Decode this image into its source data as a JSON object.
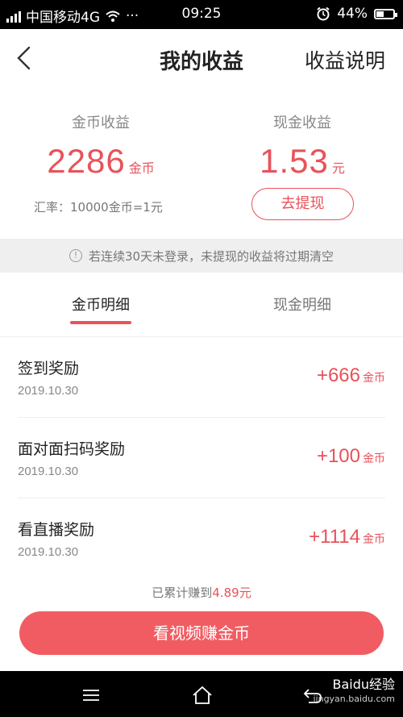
{
  "status_bar": {
    "carrier": "中国移动4G",
    "more": "···",
    "time": "09:25",
    "battery": "44%",
    "battery_level": 0.44,
    "icons": [
      "signal-icon",
      "wifi-icon",
      "alarm-icon",
      "battery-icon"
    ]
  },
  "header": {
    "title": "我的收益",
    "explain_link": "收益说明",
    "back_icon": "chevron-left-icon"
  },
  "coin": {
    "label": "金币收益",
    "amount": "2286",
    "unit": "金币",
    "rate": "汇率：10000金币=1元"
  },
  "cash": {
    "label": "现金收益",
    "amount": "1.53",
    "unit": "元",
    "withdraw_label": "去提现"
  },
  "notice": {
    "text": "若连续30天未登录，未提现的收益将过期清空",
    "icon": "info-icon"
  },
  "tabs": [
    {
      "label": "金币明细",
      "active": true
    },
    {
      "label": "现金明细",
      "active": false
    }
  ],
  "records": [
    {
      "title": "签到奖励",
      "date": "2019.10.30",
      "value": "+666",
      "unit": "金币"
    },
    {
      "title": "面对面扫码奖励",
      "date": "2019.10.30",
      "value": "+100",
      "unit": "金币"
    },
    {
      "title": "看直播奖励",
      "date": "2019.10.30",
      "value": "+1114",
      "unit": "金币"
    }
  ],
  "footer": {
    "total_prefix": "已累计赚到",
    "total_value": "4.89元",
    "cta_label": "看视频赚金币"
  },
  "nav": {
    "icons": [
      "menu-icon",
      "home-icon",
      "back-icon"
    ],
    "watermark": "Baidu经验",
    "watermark_url": "jingyan.baidu.com"
  },
  "colors": {
    "accent": "#e8525a",
    "cta": "#f15c63",
    "notice_bg": "#efefef"
  }
}
